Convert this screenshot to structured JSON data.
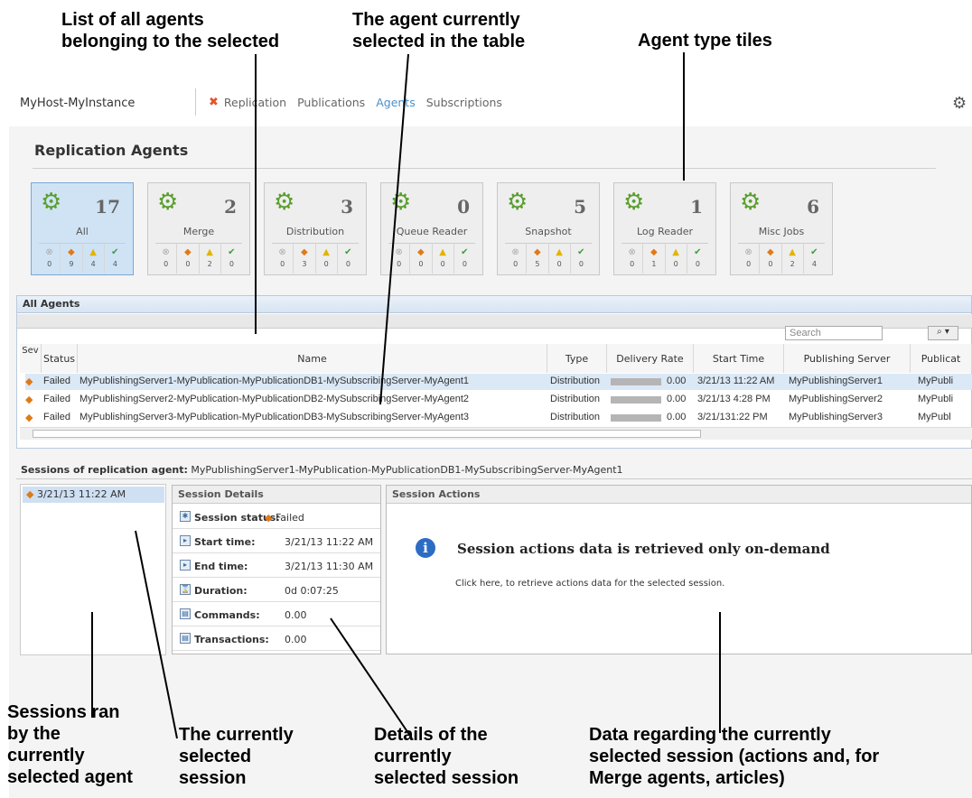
{
  "callouts": {
    "agents_list": "List of all agents\nbelonging to the selected",
    "agent_selected": "The agent currently\nselected in the table",
    "tiles": "Agent type tiles",
    "sessions_ran": "Sessions ran\nby the\ncurrently\nselected agent",
    "current_session": "The currently\nselected\nsession",
    "details": "Details of the\ncurrently\nselected session",
    "data": "Data regarding the currently\nselected session (actions and, for\nMerge agents, articles)"
  },
  "header": {
    "host": "MyHost-MyInstance",
    "nav": [
      "Replication",
      "Publications",
      "Agents",
      "Subscriptions"
    ],
    "active_nav": "Agents",
    "settings_icon": "gear-icon"
  },
  "page": {
    "title": "Replication Agents"
  },
  "tiles": [
    {
      "name": "All",
      "count": "17",
      "stats": [
        "0",
        "9",
        "4",
        "4"
      ],
      "selected": true
    },
    {
      "name": "Merge",
      "count": "2",
      "stats": [
        "0",
        "0",
        "2",
        "0"
      ]
    },
    {
      "name": "Distribution",
      "count": "3",
      "stats": [
        "0",
        "3",
        "0",
        "0"
      ]
    },
    {
      "name": "Queue Reader",
      "count": "0",
      "stats": [
        "0",
        "0",
        "0",
        "0"
      ]
    },
    {
      "name": "Snapshot",
      "count": "5",
      "stats": [
        "0",
        "5",
        "0",
        "0"
      ]
    },
    {
      "name": "Log Reader",
      "count": "1",
      "stats": [
        "0",
        "1",
        "0",
        "0"
      ]
    },
    {
      "name": "Misc Jobs",
      "count": "6",
      "stats": [
        "0",
        "0",
        "2",
        "4"
      ]
    }
  ],
  "agents_panel": {
    "title": "All Agents",
    "search_placeholder": "Search",
    "columns": [
      "Sev",
      "Status",
      "Name",
      "Type",
      "Delivery Rate",
      "Start Time",
      "Publishing Server",
      "Publicat"
    ],
    "rows": [
      {
        "status": "Failed",
        "name": "MyPublishingServer1-MyPublication-MyPublicationDB1-MySubscribingServer-MyAgent1",
        "type": "Distribution",
        "rate": "0.00",
        "start": "3/21/13 11:22 AM",
        "server": "MyPublishingServer1",
        "pub": "MyPubli"
      },
      {
        "status": "Failed",
        "name": "MyPublishingServer2-MyPublication-MyPublicationDB2-MySubscribingServer-MyAgent2",
        "type": "Distribution",
        "rate": "0.00",
        "start": "3/21/13 4:28 PM",
        "server": "MyPublishingServer2",
        "pub": "MyPubli"
      },
      {
        "status": "Failed",
        "name": "MyPublishingServer3-MyPublication-MyPublicationDB3-MySubscribingServer-MyAgent3",
        "type": "Distribution",
        "rate": "0.00",
        "start": "3/21/131:22 PM",
        "server": "MyPublishingServer3",
        "pub": "MyPubl"
      }
    ]
  },
  "sessions": {
    "label": "Sessions of replication agent:",
    "agent": "MyPublishingServer1-MyPublication-MyPublicationDB1-MySubscribingServer-MyAgent1",
    "items": [
      "3/21/13 11:22 AM"
    ],
    "details_title": "Session Details",
    "details": [
      {
        "label": "Session status:",
        "value": "Failed"
      },
      {
        "label": "Start time:",
        "value": "3/21/13 11:22 AM"
      },
      {
        "label": "End time:",
        "value": "3/21/13 11:30 AM"
      },
      {
        "label": "Duration:",
        "value": "0d 0:07:25"
      },
      {
        "label": "Commands:",
        "value": "0.00"
      },
      {
        "label": "Transactions:",
        "value": "0.00"
      }
    ],
    "actions_title": "Session Actions",
    "actions_message": "Session actions data is retrieved only on-demand",
    "actions_link": "Click here, to retrieve actions data for the selected session."
  },
  "colors": {
    "accent": "#4a90c8",
    "failed": "#e07a18",
    "warning": "#e3b400",
    "ok": "#3aa03a"
  }
}
